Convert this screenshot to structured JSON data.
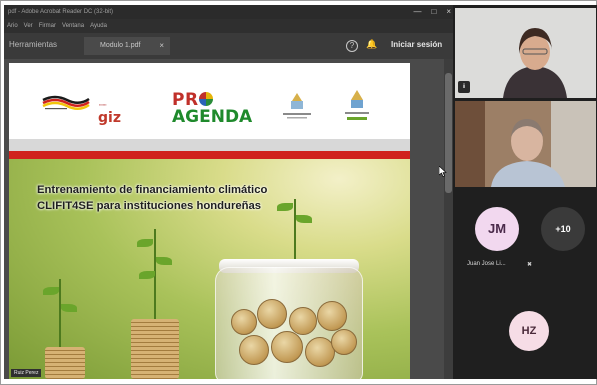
{
  "acrobat": {
    "window_title": "pdf - Adobe Acrobat Reader DC (32-bit)",
    "menu": [
      "Ario",
      "Ver",
      "Firmar",
      "Ventana",
      "Ayuda"
    ],
    "tabs": {
      "tools": "Herramientas",
      "document": "Modulo 1.pdf",
      "close": "×"
    },
    "sign_in": "Iniciar sesión",
    "help": "?",
    "controls": [
      "—",
      "□",
      "×"
    ]
  },
  "slide": {
    "title_line1": "Entrenamiento de financiamiento climático",
    "title_line2": "CLIFIT4SE para instituciones hondureñas",
    "giz": "giz",
    "proagenda_top": "PR",
    "proagenda_bottom": "AGENDA",
    "presenter_tag": "Ruiz Perez",
    "accent_red": "#d0221d"
  },
  "participants": {
    "tile1_label": "ii",
    "jm_initials": "JM",
    "jm_name": "Juan Jose Li...",
    "more_count": "+10",
    "hz_initials": "HZ"
  }
}
